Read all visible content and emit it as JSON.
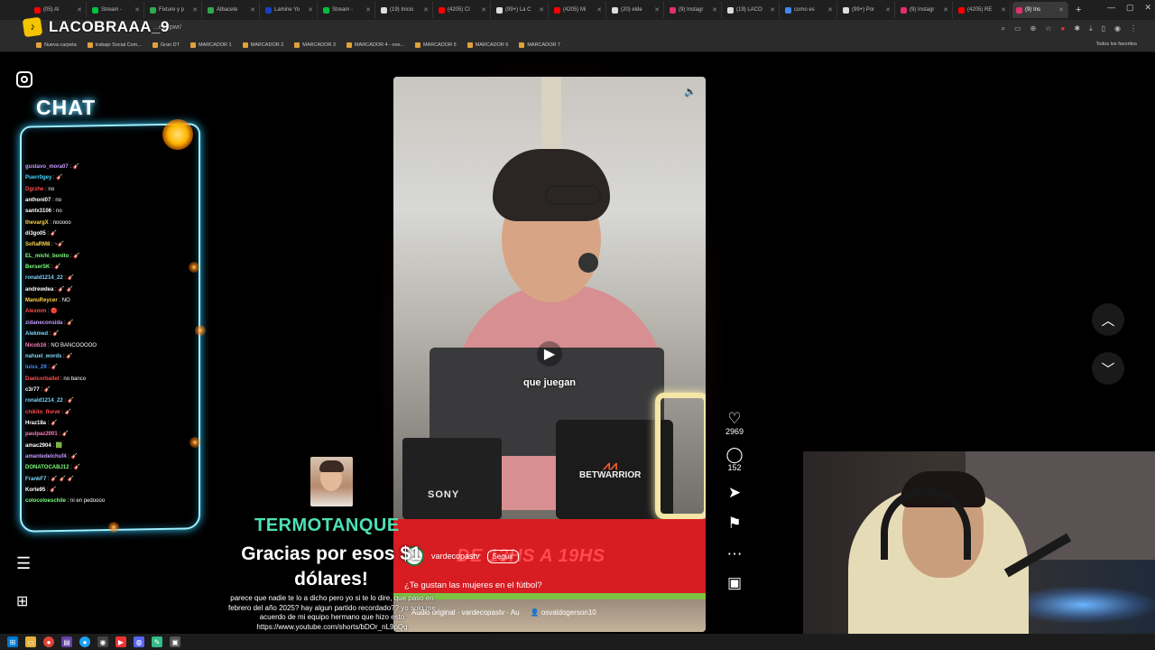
{
  "browser": {
    "tabs": [
      {
        "label": "(05) Al",
        "color": "#ff0000"
      },
      {
        "label": "Stream -",
        "color": "#00c040"
      },
      {
        "label": "Fixture y p",
        "color": "#2fa84f"
      },
      {
        "label": "Albacete",
        "color": "#2fa84f"
      },
      {
        "label": "Lamine Yo",
        "color": "#1a3fbf"
      },
      {
        "label": "Stream -",
        "color": "#00c040"
      },
      {
        "label": "(19) Inicio",
        "color": "#dddddd"
      },
      {
        "label": "(4205) Cl",
        "color": "#ff0000"
      },
      {
        "label": "(99+) La C",
        "color": "#dddddd"
      },
      {
        "label": "(4205) Mi",
        "color": "#ff0000"
      },
      {
        "label": "(20) elde",
        "color": "#dddddd"
      },
      {
        "label": "(9) Instagr",
        "color": "#e1306c"
      },
      {
        "label": "(19) LACO",
        "color": "#dddddd"
      },
      {
        "label": "como es",
        "color": "#4285f4"
      },
      {
        "label": "(99+) Por",
        "color": "#dddddd"
      },
      {
        "label": "(9) Instagr",
        "color": "#e1306c"
      },
      {
        "label": "(4205) RE",
        "color": "#ff0000"
      },
      {
        "label": "(9) Ins",
        "color": "#e1306c",
        "active": true
      }
    ],
    "url_fragment": "...eqFpwr/",
    "bookmarks": [
      "Nueva carpeta",
      "trabajo Social Com...",
      "Gran DT",
      "MARCADOR 1",
      "MARCADOR 2",
      "MARCADOR 3",
      "MARCADOR 4 - ove...",
      "MARCADOR 5",
      "MARCADOR 6",
      "MARCADOR 7"
    ],
    "bookmarks_right": "Todos los favoritos"
  },
  "overlay": {
    "channel_logo": "LACOBRAAA_9",
    "chat_title": "CHAT"
  },
  "chat": [
    {
      "user": "gustavo_mora07",
      "msg": "🎸",
      "color": "#c79bff"
    },
    {
      "user": "Puerr0gey",
      "msg": "🎸",
      "color": "#4ad3ff"
    },
    {
      "user": "Dgrzhe",
      "msg": "no",
      "color": "#ff4d4d"
    },
    {
      "user": "anthoni07",
      "msg": "no",
      "color": "#ffffff"
    },
    {
      "user": "santx3106",
      "msg": "no",
      "color": "#ffffff"
    },
    {
      "user": "thevargX",
      "msg": "nooooo",
      "color": "#ffd54a"
    },
    {
      "user": "di3go05",
      "msg": "🎸",
      "color": "#ffffff"
    },
    {
      "user": "SofiaRM8",
      "msg": "~🎸",
      "color": "#ffd54a"
    },
    {
      "user": "EL_michi_bonito",
      "msg": "🎸",
      "color": "#7cff7c"
    },
    {
      "user": "BerserSK",
      "msg": "🎸",
      "color": "#7cff7c"
    },
    {
      "user": "ronald1214_22",
      "msg": "🎸",
      "color": "#7cd7ff"
    },
    {
      "user": "andrewdea",
      "msg": "🎸 🎸",
      "color": "#ffffff"
    },
    {
      "user": "ManuReycer",
      "msg": "NO",
      "color": "#ffd54a"
    },
    {
      "user": "Alexmm",
      "msg": "🔴",
      "color": "#ff4d4d"
    },
    {
      "user": "zidaneconsida",
      "msg": "🎸",
      "color": "#c79bff"
    },
    {
      "user": "Alekmed",
      "msg": "🎸",
      "color": "#7cd7ff"
    },
    {
      "user": "Nicob16",
      "msg": "NO BANCOOOOO",
      "color": "#ff7fbf"
    },
    {
      "user": "nahuel_words",
      "msg": "🎸",
      "color": "#7cd7ff"
    },
    {
      "user": "luiss_29",
      "msg": "🎸",
      "color": "#4a8dff"
    },
    {
      "user": "Daelcorballel",
      "msg": "no banco",
      "color": "#ff4d4d"
    },
    {
      "user": "c3r77",
      "msg": "🎸",
      "color": "#ffffff"
    },
    {
      "user": "ronald1214_22",
      "msg": "🎸",
      "color": "#7cd7ff"
    },
    {
      "user": "chikito_florwi",
      "msg": "🎸",
      "color": "#ff4d4d"
    },
    {
      "user": "Hraz18a",
      "msg": "🎸",
      "color": "#ffffff"
    },
    {
      "user": "paulpaz2001",
      "msg": "🎸",
      "color": "#ff7fbf"
    },
    {
      "user": "amac2904",
      "msg": "🟩",
      "color": "#ffffff"
    },
    {
      "user": "amantedelchuf4",
      "msg": "🎸",
      "color": "#c79bff"
    },
    {
      "user": "DONATOCABJ12",
      "msg": "🎸",
      "color": "#7cff7c"
    },
    {
      "user": "FrankF7",
      "msg": "🎸 🎸 🎸",
      "color": "#7cd7ff"
    },
    {
      "user": "Korte95",
      "msg": "🎸",
      "color": "#ffffff"
    },
    {
      "user": "colocoloeschile",
      "msg": "ni en pedoooo",
      "color": "#7cff7c"
    }
  ],
  "donation": {
    "name": "TERMOTANQUE",
    "message": "Gracias por esos $1 dólares!",
    "sub": "parece que nadie te lo a dicho pero yo si te lo dire, que paso en febrero del año 2025? hay algun partido recordado?? yo solo me acuerdo de mi equipo hermano que hizo esto https://www.youtube.com/shorts/bDOr_nL9pQg"
  },
  "reel": {
    "caption": "que juegan",
    "brand_left": "SONY",
    "brand_right": "BETWARRIOR",
    "banner": "DE 13HS A 19HS",
    "author": "vardecopastv",
    "follow": "Seguir",
    "description": "¿Te gustan las mujeres en el fútbol?",
    "audio": "Audio original · vardecopastv · Au",
    "tagged": "osvaldogerson10",
    "likes": "2969",
    "comments": "152"
  }
}
